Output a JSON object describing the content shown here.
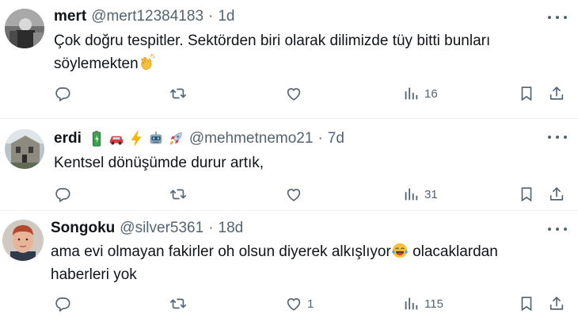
{
  "tweets": [
    {
      "name": "mert",
      "handle": "@mert12384183",
      "dot": "·",
      "time": "1d",
      "text": "Çok doğru tespitler. Sektörden biri olarak dilimizde tüy bitti bunları söylemekten",
      "inline_emoji": "clapping-hands",
      "replies": "",
      "retweets": "",
      "likes": "",
      "views": "16"
    },
    {
      "name": "erdi",
      "name_emojis": [
        "battery",
        "red-car",
        "lightning",
        "robot",
        "rocket"
      ],
      "handle": "@mehmetnemo21",
      "dot": "·",
      "time": "7d",
      "text": "Kentsel dönüşümde durur artık,",
      "replies": "",
      "retweets": "",
      "likes": "",
      "views": "31"
    },
    {
      "name": "Songoku",
      "handle": "@silver5361",
      "dot": "·",
      "time": "18d",
      "text_before": "ama evi olmayan fakirler oh olsun diyerek alkışlıyor",
      "inline_emoji": "tears-of-joy",
      "text_after": " olacaklardan haberleri yok",
      "replies": "",
      "retweets": "",
      "likes": "1",
      "views": "115"
    }
  ],
  "colors": {
    "text": "#0f1419",
    "secondary": "#536471",
    "divider": "#eff3f4"
  }
}
